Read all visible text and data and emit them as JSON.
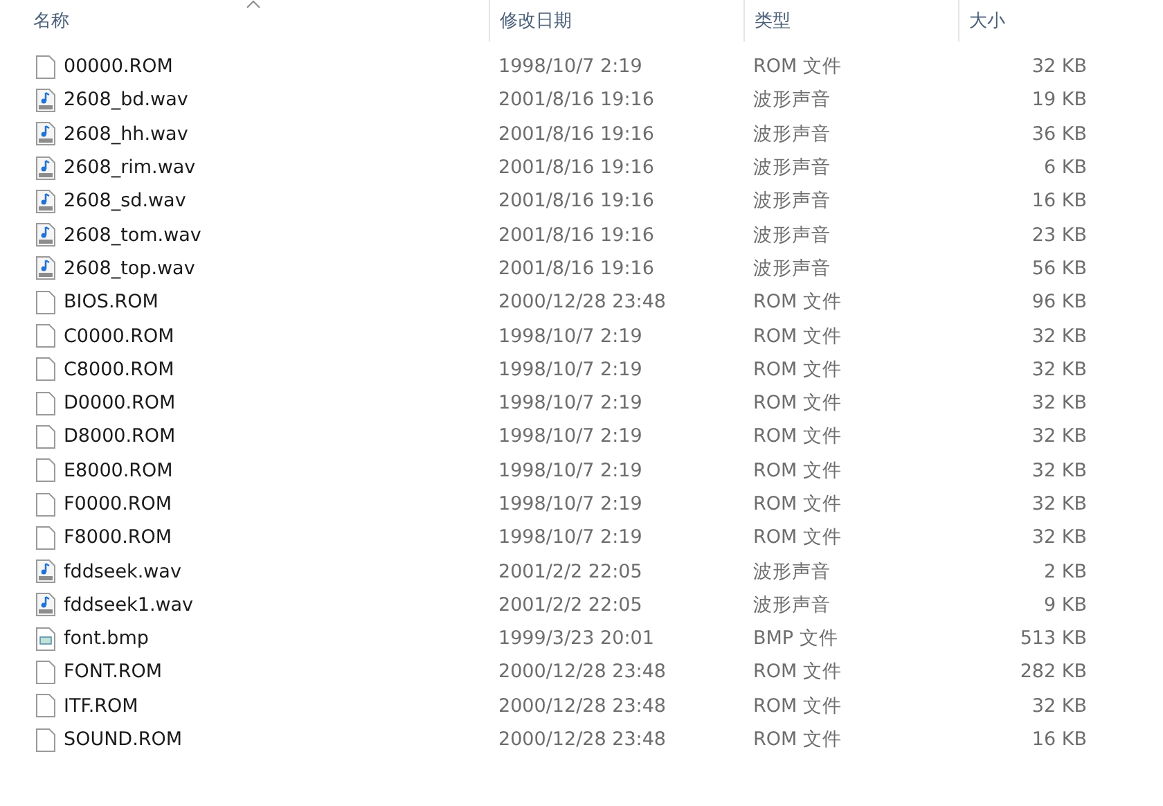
{
  "columns": [
    {
      "label": "名称",
      "sorted": true
    },
    {
      "label": "修改日期",
      "sorted": false
    },
    {
      "label": "类型",
      "sorted": false
    },
    {
      "label": "大小",
      "sorted": false
    }
  ],
  "rows": [
    {
      "kind": "rom",
      "name": "00000.ROM",
      "date": "1998/10/7 2:19",
      "type": "ROM 文件",
      "size": "32 KB"
    },
    {
      "kind": "wav",
      "name": "2608_bd.wav",
      "date": "2001/8/16 19:16",
      "type": "波形声音",
      "size": "19 KB"
    },
    {
      "kind": "wav",
      "name": "2608_hh.wav",
      "date": "2001/8/16 19:16",
      "type": "波形声音",
      "size": "36 KB"
    },
    {
      "kind": "wav",
      "name": "2608_rim.wav",
      "date": "2001/8/16 19:16",
      "type": "波形声音",
      "size": "6 KB"
    },
    {
      "kind": "wav",
      "name": "2608_sd.wav",
      "date": "2001/8/16 19:16",
      "type": "波形声音",
      "size": "16 KB"
    },
    {
      "kind": "wav",
      "name": "2608_tom.wav",
      "date": "2001/8/16 19:16",
      "type": "波形声音",
      "size": "23 KB"
    },
    {
      "kind": "wav",
      "name": "2608_top.wav",
      "date": "2001/8/16 19:16",
      "type": "波形声音",
      "size": "56 KB"
    },
    {
      "kind": "rom",
      "name": "BIOS.ROM",
      "date": "2000/12/28 23:48",
      "type": "ROM 文件",
      "size": "96 KB"
    },
    {
      "kind": "rom",
      "name": "C0000.ROM",
      "date": "1998/10/7 2:19",
      "type": "ROM 文件",
      "size": "32 KB"
    },
    {
      "kind": "rom",
      "name": "C8000.ROM",
      "date": "1998/10/7 2:19",
      "type": "ROM 文件",
      "size": "32 KB"
    },
    {
      "kind": "rom",
      "name": "D0000.ROM",
      "date": "1998/10/7 2:19",
      "type": "ROM 文件",
      "size": "32 KB"
    },
    {
      "kind": "rom",
      "name": "D8000.ROM",
      "date": "1998/10/7 2:19",
      "type": "ROM 文件",
      "size": "32 KB"
    },
    {
      "kind": "rom",
      "name": "E8000.ROM",
      "date": "1998/10/7 2:19",
      "type": "ROM 文件",
      "size": "32 KB"
    },
    {
      "kind": "rom",
      "name": "F0000.ROM",
      "date": "1998/10/7 2:19",
      "type": "ROM 文件",
      "size": "32 KB"
    },
    {
      "kind": "rom",
      "name": "F8000.ROM",
      "date": "1998/10/7 2:19",
      "type": "ROM 文件",
      "size": "32 KB"
    },
    {
      "kind": "wav",
      "name": "fddseek.wav",
      "date": "2001/2/2 22:05",
      "type": "波形声音",
      "size": "2 KB"
    },
    {
      "kind": "wav",
      "name": "fddseek1.wav",
      "date": "2001/2/2 22:05",
      "type": "波形声音",
      "size": "9 KB"
    },
    {
      "kind": "bmp",
      "name": "font.bmp",
      "date": "1999/3/23 20:01",
      "type": "BMP 文件",
      "size": "513 KB"
    },
    {
      "kind": "rom",
      "name": "FONT.ROM",
      "date": "2000/12/28 23:48",
      "type": "ROM 文件",
      "size": "282 KB"
    },
    {
      "kind": "rom",
      "name": "ITF.ROM",
      "date": "2000/12/28 23:48",
      "type": "ROM 文件",
      "size": "32 KB"
    },
    {
      "kind": "rom",
      "name": "SOUND.ROM",
      "date": "2000/12/28 23:48",
      "type": "ROM 文件",
      "size": "16 KB"
    }
  ]
}
